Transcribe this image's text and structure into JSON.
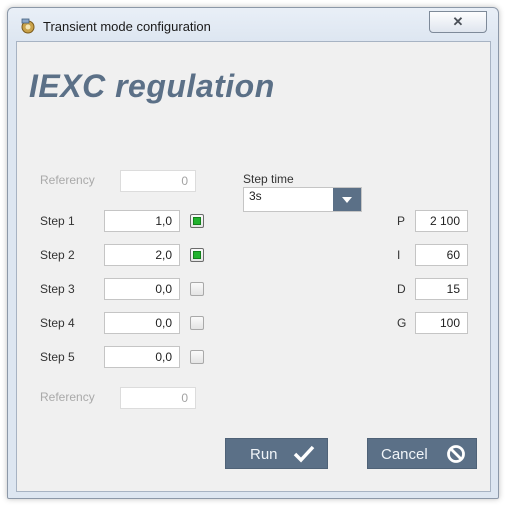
{
  "window": {
    "title": "Transient mode configuration",
    "close_label": "✕",
    "icon": "app-icon"
  },
  "heading": "IEXC regulation",
  "referency_top": {
    "label": "Referency",
    "value": "0",
    "enabled": false
  },
  "steps": [
    {
      "label": "Step 1",
      "value": "1,0",
      "checked": true
    },
    {
      "label": "Step 2",
      "value": "2,0",
      "checked": true
    },
    {
      "label": "Step 3",
      "value": "0,0",
      "checked": false
    },
    {
      "label": "Step 4",
      "value": "0,0",
      "checked": false
    },
    {
      "label": "Step 5",
      "value": "0,0",
      "checked": false
    }
  ],
  "referency_bottom": {
    "label": "Referency",
    "value": "0",
    "enabled": false
  },
  "step_time": {
    "label": "Step time",
    "value": "3s",
    "icon": "chevron-down-icon"
  },
  "pid": [
    {
      "label": "P",
      "value": "2 100"
    },
    {
      "label": "I",
      "value": "60"
    },
    {
      "label": "D",
      "value": "15"
    },
    {
      "label": "G",
      "value": "100"
    }
  ],
  "buttons": {
    "run": {
      "label": "Run",
      "icon": "check-icon"
    },
    "cancel": {
      "label": "Cancel",
      "icon": "cancel-icon"
    }
  },
  "colors": {
    "accent": "#5b7087",
    "checked_green": "#22b22e"
  }
}
